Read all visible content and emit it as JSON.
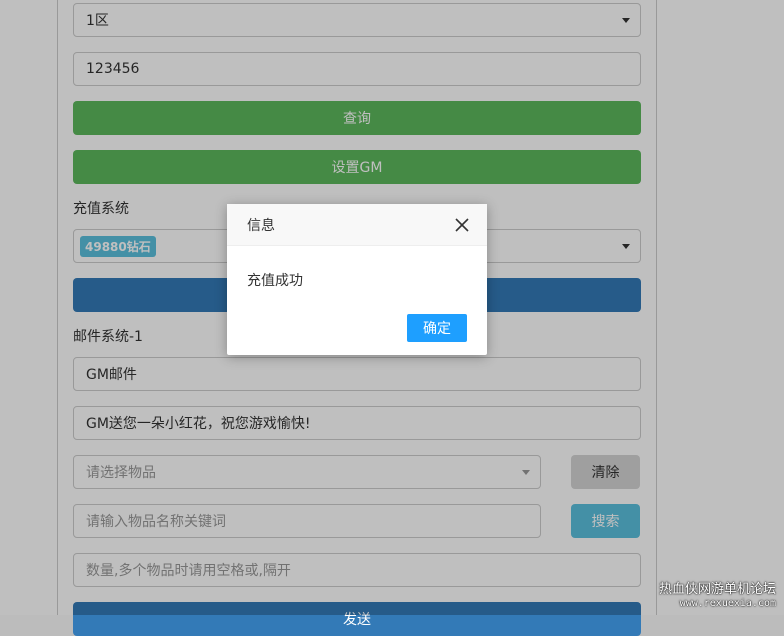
{
  "form": {
    "server_select": "1区",
    "role_id_input": "123456",
    "query_button": "查询",
    "set_gm_button": "设置GM",
    "recharge_label": "充值系统",
    "recharge_select_tag": "49880钻石",
    "recharge_button": "",
    "mail_label": "邮件系统-1",
    "mail_title_input": "GM邮件",
    "mail_content_input": "GM送您一朵小红花，祝您游戏愉快!",
    "item_select_placeholder": "请选择物品",
    "clear_button": "清除",
    "keyword_placeholder": "请输入物品名称关键词",
    "search_button": "搜索",
    "quantity_placeholder": "数量,多个物品时请用空格或,隔开",
    "send_button": "发送"
  },
  "dialog": {
    "title": "信息",
    "message": "充值成功",
    "ok_button": "确定"
  },
  "watermark": {
    "line1": "热血侠网游单机论坛",
    "line2": "www.rexuexia.com"
  },
  "colors": {
    "green": "#5cb85c",
    "blue": "#337ab7",
    "info": "#5bc0de",
    "layer_btn": "#1E9FFF"
  }
}
